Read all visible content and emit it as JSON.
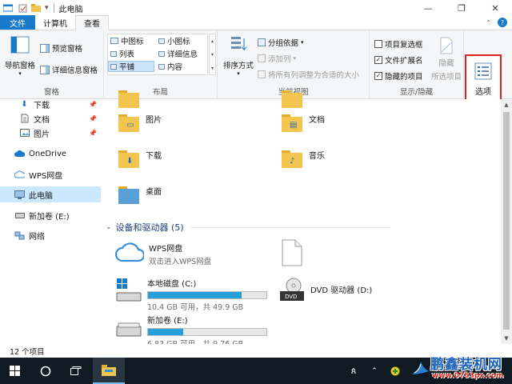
{
  "window": {
    "title": "此电脑",
    "quick_access_dropdown": "▾",
    "controls": {
      "minimize": "—",
      "maximize": "❐",
      "close": "✕"
    }
  },
  "tabs": {
    "file": "文件",
    "computer": "计算机",
    "view": "查看"
  },
  "ribbon": {
    "panes": {
      "label": "窗格",
      "nav_pane": "导航窗格",
      "preview_pane": "预览窗格",
      "details_pane": "详细信息窗格"
    },
    "layout": {
      "label": "布局",
      "items": [
        "中图标",
        "小图标",
        "列表",
        "详细信息",
        "平铺",
        "内容"
      ],
      "selected": "平铺"
    },
    "current_view": {
      "label": "当前视图",
      "sort_by": "排序方式",
      "group_by": "分组依据",
      "add_column": "添加列",
      "fit_columns": "将所有列调整为合适的大小"
    },
    "show_hide": {
      "label": "显示/隐藏",
      "item_checkboxes": "项目复选框",
      "file_extensions": "文件扩展名",
      "hidden_items": "隐藏的项目",
      "hide": "隐藏",
      "hide_selected": "所选项目",
      "item_checkboxes_checked": false,
      "file_extensions_checked": true,
      "hidden_items_checked": true
    },
    "options": "选项"
  },
  "nav": {
    "items": [
      {
        "label": "下载",
        "icon": "download-arrow-icon",
        "pinned": true
      },
      {
        "label": "文档",
        "icon": "document-icon",
        "pinned": true
      },
      {
        "label": "图片",
        "icon": "picture-icon",
        "pinned": true
      },
      {
        "label": "OneDrive",
        "icon": "cloud-icon",
        "pinned": false
      },
      {
        "label": "WPS网盘",
        "icon": "wps-cloud-icon",
        "pinned": false
      },
      {
        "label": "此电脑",
        "icon": "computer-icon",
        "pinned": false
      },
      {
        "label": "新加卷 (E:)",
        "icon": "drive-icon",
        "pinned": false
      },
      {
        "label": "网络",
        "icon": "network-icon",
        "pinned": false
      }
    ],
    "selected": "此电脑"
  },
  "folders": {
    "items": [
      "图片",
      "文档",
      "下载",
      "音乐",
      "桌面"
    ]
  },
  "devices": {
    "header": "设备和驱动器 (5)",
    "wps": {
      "name": "WPS网盘",
      "sub": "双击进入WPS网盘"
    },
    "local_c": {
      "name": "本地磁盘 (C:)",
      "space": "10.4 GB 可用，共 49.9 GB",
      "used_fraction": 0.79
    },
    "dvd": {
      "name": "DVD 驱动器 (D:)"
    },
    "new_e": {
      "name": "新加卷 (E:)",
      "space": "6.83 GB 可用，共 9.76 GB",
      "used_fraction": 0.3
    }
  },
  "status": {
    "count": "12 个项目"
  },
  "watermark": {
    "brand": "鹏鑫装机网",
    "url": "www.0753px.com"
  },
  "colors": {
    "accent": "#1979ca",
    "highlight": "#e0201b",
    "folder": "#f3c54e",
    "drive_bar": "#26a0da"
  }
}
